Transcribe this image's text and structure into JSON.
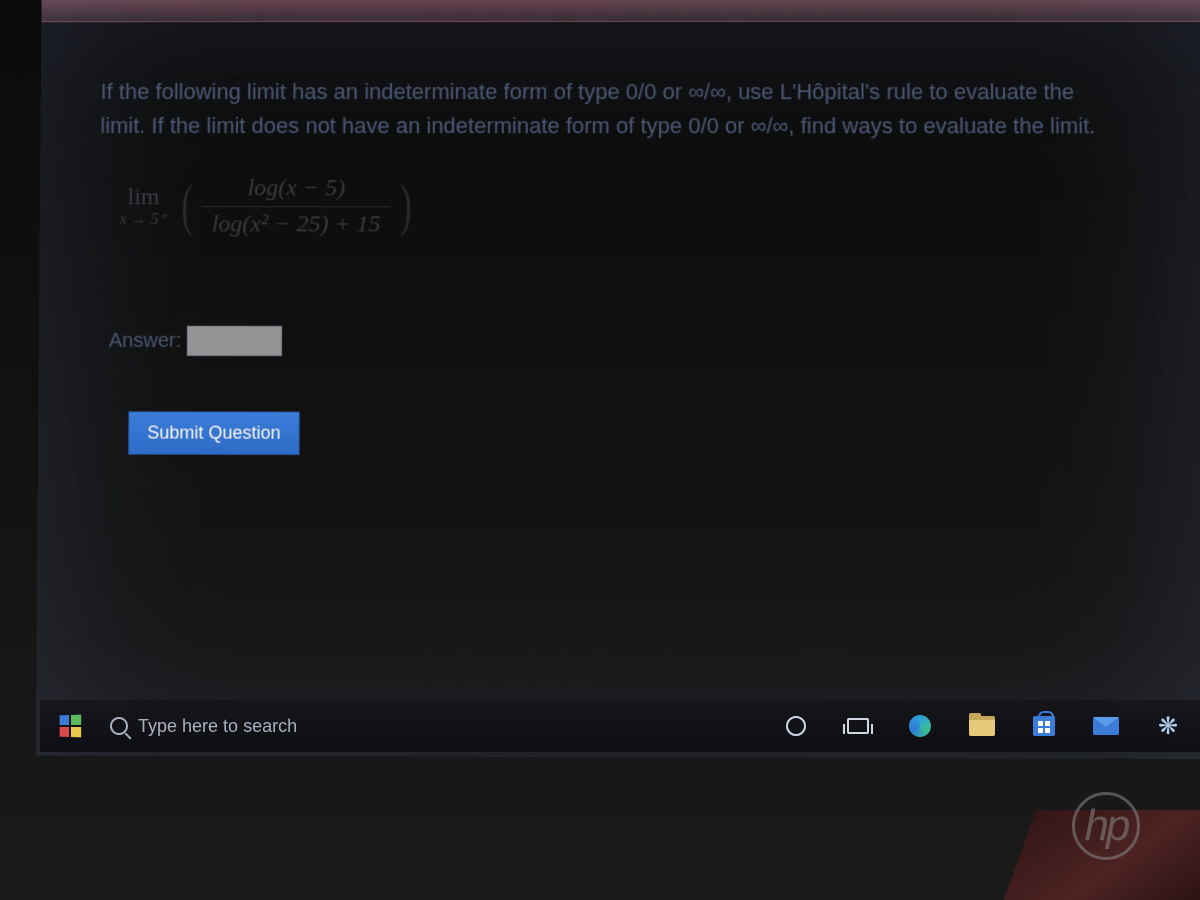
{
  "question": {
    "text": "If the following limit has an indeterminate form of type 0/0 or ∞/∞, use L'Hôpital's rule to evaluate the limit. If the limit does not have an indeterminate form of type 0/0 or ∞/∞, find ways to evaluate the limit."
  },
  "math": {
    "lim_word": "lim",
    "lim_sub": "x → 5⁺",
    "numerator": "log(x − 5)",
    "denominator": "log(x² − 25) + 15"
  },
  "answer": {
    "label": "Answer:",
    "value": ""
  },
  "submit": {
    "label": "Submit Question"
  },
  "taskbar": {
    "search_placeholder": "Type here to search"
  },
  "hp_logo": "hp"
}
